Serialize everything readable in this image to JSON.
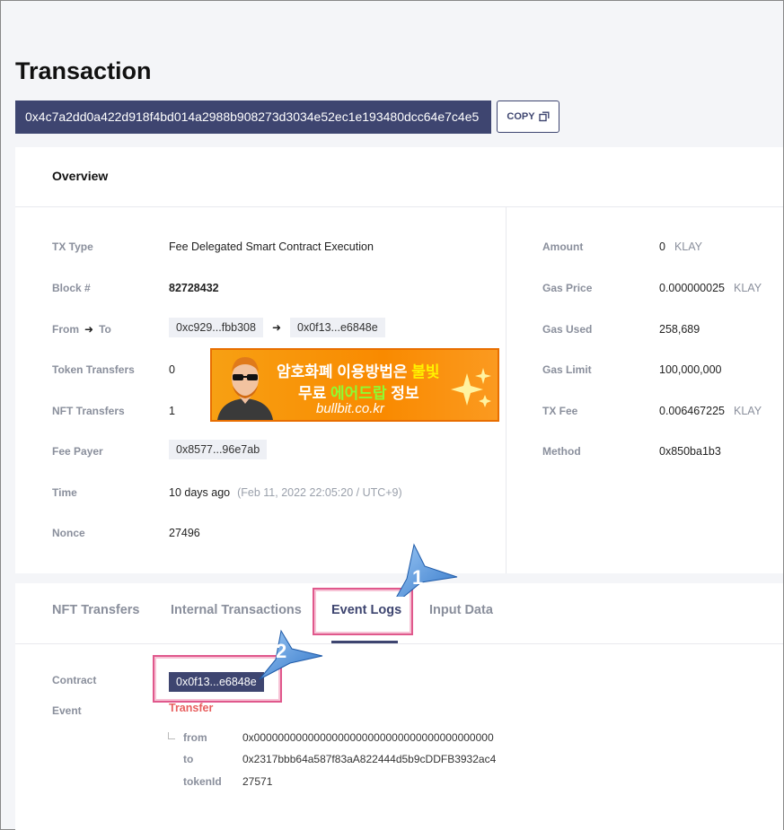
{
  "page": {
    "title": "Transaction",
    "tx_hash": "0x4c7a2dd0a422d918f4bd014a2988b908273d3034e52ec1e193480dcc64e7c4e5",
    "copy_label": "COPY"
  },
  "overview": {
    "heading": "Overview",
    "left": {
      "tx_type_label": "TX Type",
      "tx_type_value": "Fee Delegated Smart Contract Execution",
      "block_label": "Block #",
      "block_value": "82728432",
      "from_label": "From",
      "to_label": "To",
      "from_value": "0xc929...fbb308",
      "to_value": "0x0f13...e6848e",
      "token_transfers_label": "Token Transfers",
      "token_transfers_value": "0",
      "nft_transfers_label": "NFT Transfers",
      "nft_transfers_value": "1",
      "fee_payer_label": "Fee Payer",
      "fee_payer_value": "0x8577...96e7ab",
      "time_label": "Time",
      "time_value": "10 days ago",
      "time_detail": "(Feb 11, 2022 22:05:20 / UTC+9)",
      "nonce_label": "Nonce",
      "nonce_value": "27496"
    },
    "right": {
      "amount_label": "Amount",
      "amount_value": "0",
      "amount_unit": "KLAY",
      "gas_price_label": "Gas Price",
      "gas_price_value": "0.000000025",
      "gas_price_unit": "KLAY",
      "gas_used_label": "Gas Used",
      "gas_used_value": "258,689",
      "gas_limit_label": "Gas Limit",
      "gas_limit_value": "100,000,000",
      "tx_fee_label": "TX Fee",
      "tx_fee_value": "0.006467225",
      "tx_fee_unit": "KLAY",
      "method_label": "Method",
      "method_value": "0x850ba1b3"
    }
  },
  "ad": {
    "line1_a": "암호화폐 이용방법은 ",
    "line1_b": "불빛",
    "line2_a": "무료 ",
    "line2_b": "에어드랍",
    "line2_c": " 정보",
    "line3": "bullbit.co.kr"
  },
  "tabs": [
    {
      "label": "NFT Transfers"
    },
    {
      "label": "Internal Transactions"
    },
    {
      "label": "Event Logs"
    },
    {
      "label": "Input Data"
    }
  ],
  "event_log": {
    "contract_label": "Contract",
    "contract_value": "0x0f13...e6848e",
    "event_label": "Event",
    "event_name": "Transfer",
    "params": [
      {
        "key": "from",
        "value": "0x0000000000000000000000000000000000000000"
      },
      {
        "key": "to",
        "value": "0x2317bbb64a587f83aA822444d5b9cDDFB3932ac4"
      },
      {
        "key": "tokenId",
        "value": "27571"
      }
    ]
  },
  "callouts": [
    "1",
    "2"
  ],
  "colors": {
    "accent": "#3e4570",
    "highlight": "#e0588c",
    "event": "#e85e5e",
    "callout": "#4a90e2"
  }
}
